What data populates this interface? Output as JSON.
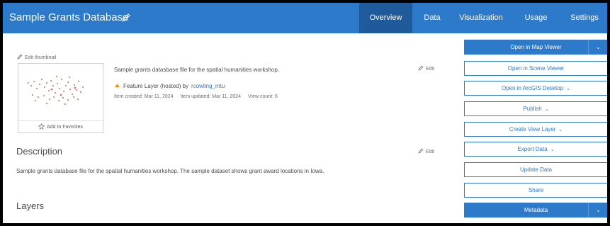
{
  "header": {
    "title": "Sample Grants Database",
    "tabs": [
      {
        "label": "Overview"
      },
      {
        "label": "Data"
      },
      {
        "label": "Visualization"
      },
      {
        "label": "Usage"
      },
      {
        "label": "Settings"
      }
    ]
  },
  "thumbnail": {
    "edit_label": "Edit thumbnail",
    "favorites_label": "Add to Favorites"
  },
  "summary": {
    "text": "Sample grants datasbase file for the spatial humanities workshop.",
    "edit_label": "Edit",
    "layer_type": "Feature Layer (hosted) by",
    "owner": "rcowling_mtu",
    "created": "Item created: Mar 11, 2024",
    "updated": "Item updated: Mar 11, 2024",
    "views": "View count: 6"
  },
  "description": {
    "heading": "Description",
    "edit_label": "Edit",
    "text": "Sample grants database file for the spatial humanities workshop. The sample dataset shows grant award locations in Iowa."
  },
  "layers": {
    "heading": "Layers"
  },
  "actions": {
    "open_map_viewer": "Open in Map Viewer",
    "open_scene_viewer": "Open in Scene Viewer",
    "open_desktop": "Open in ArcGIS Desktop",
    "publish": "Publish",
    "create_view_layer": "Create View Layer",
    "export_data": "Export Data",
    "update_data": "Update Data",
    "share": "Share",
    "metadata": "Metadata"
  },
  "colors": {
    "brand": "#2c7ac9",
    "active_tab": "#1f5a9a",
    "map_points": "#e06b4a"
  },
  "icons": {
    "pencil": "pencil-icon",
    "star": "star-icon",
    "layer": "feature-layer-icon",
    "chevron": "chevron-down-icon"
  }
}
